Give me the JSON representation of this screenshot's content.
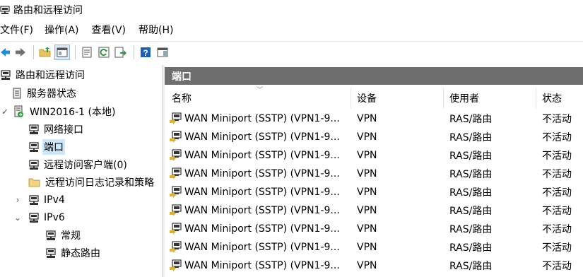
{
  "window": {
    "title": "路由和远程访问"
  },
  "menu": [
    "文件(F)",
    "操作(A)",
    "查看(V)",
    "帮助(H)"
  ],
  "tree": {
    "root": "路由和远程访问",
    "server_status": "服务器状态",
    "server": "WIN2016-1 (本地)",
    "network_interfaces": "网络接口",
    "ports": "端口",
    "remote_clients": "远程访问客户端(0)",
    "logging_policy": "远程访问日志记录和策略",
    "ipv4": "IPv4",
    "ipv6": "IPv6",
    "general": "常规",
    "static_routes": "静态路由"
  },
  "pane": {
    "title": "端口"
  },
  "table": {
    "columns": [
      "名称",
      "设备",
      "使用者",
      "状态"
    ],
    "rows": [
      {
        "name": "WAN Miniport (SSTP) (VPN1-9...",
        "device": "VPN",
        "used_by": "RAS/路由",
        "status": "不活动"
      },
      {
        "name": "WAN Miniport (SSTP) (VPN1-9...",
        "device": "VPN",
        "used_by": "RAS/路由",
        "status": "不活动"
      },
      {
        "name": "WAN Miniport (SSTP) (VPN1-9...",
        "device": "VPN",
        "used_by": "RAS/路由",
        "status": "不活动"
      },
      {
        "name": "WAN Miniport (SSTP) (VPN1-9...",
        "device": "VPN",
        "used_by": "RAS/路由",
        "status": "不活动"
      },
      {
        "name": "WAN Miniport (SSTP) (VPN1-9...",
        "device": "VPN",
        "used_by": "RAS/路由",
        "status": "不活动"
      },
      {
        "name": "WAN Miniport (SSTP) (VPN1-9...",
        "device": "VPN",
        "used_by": "RAS/路由",
        "status": "不活动"
      },
      {
        "name": "WAN Miniport (SSTP) (VPN1-9...",
        "device": "VPN",
        "used_by": "RAS/路由",
        "status": "不活动"
      },
      {
        "name": "WAN Miniport (SSTP) (VPN1-9...",
        "device": "VPN",
        "used_by": "RAS/路由",
        "status": "不活动"
      },
      {
        "name": "WAN Miniport (SSTP) (VPN1-9...",
        "device": "VPN",
        "used_by": "RAS/路由",
        "status": "不活动"
      }
    ]
  },
  "colors": {
    "pane_header": "#6e6e6e",
    "selection": "#cce8ff"
  }
}
